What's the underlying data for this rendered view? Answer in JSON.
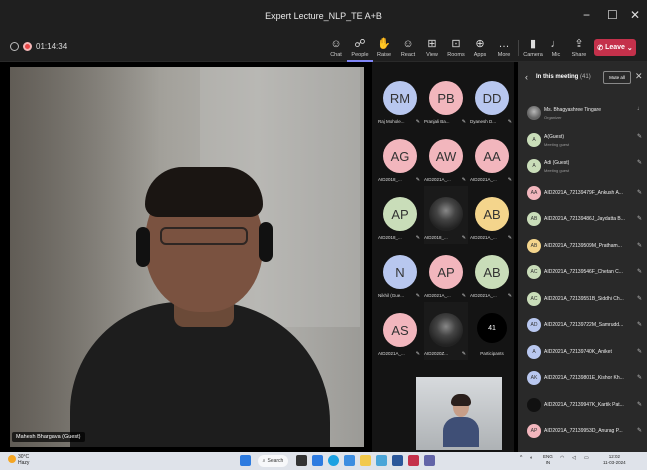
{
  "window": {
    "title": "Expert Lecture_NLP_TE A+B",
    "controls": [
      "−",
      "☐",
      "✕"
    ]
  },
  "toolbar": {
    "timer": "01:14:34",
    "buttons": [
      {
        "label": "Chat",
        "icon": "chat-icon",
        "glyph": "☺"
      },
      {
        "label": "People",
        "icon": "people-icon",
        "glyph": "☍"
      },
      {
        "label": "Raise",
        "icon": "raise-hand-icon",
        "glyph": "✋"
      },
      {
        "label": "React",
        "icon": "react-icon",
        "glyph": "☺"
      },
      {
        "label": "View",
        "icon": "view-icon",
        "glyph": "⊞"
      },
      {
        "label": "Rooms",
        "icon": "rooms-icon",
        "glyph": "⊡"
      },
      {
        "label": "Apps",
        "icon": "apps-icon",
        "glyph": "⊕"
      },
      {
        "label": "More",
        "icon": "more-icon",
        "glyph": "…"
      },
      {
        "label": "Camera",
        "icon": "camera-icon",
        "glyph": "▮"
      },
      {
        "label": "Mic",
        "icon": "mic-icon",
        "glyph": "♩"
      },
      {
        "label": "Share",
        "icon": "share-icon",
        "glyph": "⇪"
      }
    ],
    "leave_label": "Leave"
  },
  "stage": {
    "speaker_name": "Mahesh Bhargava (Guest)"
  },
  "gallery": {
    "tiles": [
      {
        "initials": "RM",
        "name": "Raj Mohole...",
        "color": "#b8c7ef"
      },
      {
        "initials": "PB",
        "name": "Pranjali Ba...",
        "color": "#f2b6bd"
      },
      {
        "initials": "DD",
        "name": "Dyanesh D...",
        "color": "#b8c7ef"
      },
      {
        "initials": "AG",
        "name": "AID2018_...",
        "color": "#f2b6bd"
      },
      {
        "initials": "AW",
        "name": "AID2021A_...",
        "color": "#f2b6bd"
      },
      {
        "initials": "AA",
        "name": "AID2021A_...",
        "color": "#f2b6bd"
      },
      {
        "initials": "AP",
        "name": "AID2018_...",
        "color": "#c9ddb9"
      },
      {
        "initials": "",
        "name": "AID2018_...",
        "color": "#333333",
        "photo": true
      },
      {
        "initials": "AB",
        "name": "AID2021A_...",
        "color": "#f4d58c"
      },
      {
        "initials": "N",
        "name": "Nikhil (Gue...",
        "color": "#b8c7ef"
      },
      {
        "initials": "AP",
        "name": "AID2021A_...",
        "color": "#f2b6bd"
      },
      {
        "initials": "AB",
        "name": "AID2021A_...",
        "color": "#c9ddb9"
      },
      {
        "initials": "AS",
        "name": "AID2021A_...",
        "color": "#f2b6bd"
      },
      {
        "initials": "",
        "name": "AID2020Z...",
        "color": "#333333",
        "photo": true
      },
      {
        "initials": "41",
        "name": "Participants",
        "color": "#000000",
        "count": true
      }
    ]
  },
  "panel": {
    "title": "In this meeting",
    "count": "(41)",
    "mute_all_label": "Mute all",
    "participants": [
      {
        "initials": "",
        "name": "Ms. Bhagyashree Tingare",
        "role": "Organizer",
        "photo": true,
        "color": "#999999"
      },
      {
        "initials": "A",
        "name": "A(Guest)",
        "role": "Meeting guest",
        "color": "#c9ddb9"
      },
      {
        "initials": "A",
        "name": "Adi (Guest)",
        "role": "Meeting guest",
        "color": "#c9ddb9"
      },
      {
        "initials": "AA",
        "name": "AID2021A_72139479F_Ankush A...",
        "role": "",
        "color": "#f2b6bd"
      },
      {
        "initials": "AB",
        "name": "AID2021A_72139486J_Jaydatta B...",
        "role": "",
        "color": "#c9ddb9"
      },
      {
        "initials": "AB",
        "name": "AID2021A_72139509M_Pratham...",
        "role": "",
        "color": "#f4d58c"
      },
      {
        "initials": "AC",
        "name": "AID2021A_72139546F_Chetan C...",
        "role": "",
        "color": "#c9ddb9"
      },
      {
        "initials": "AC",
        "name": "AID2021A_72139551B_Siddhi Ch...",
        "role": "",
        "color": "#c9ddb9"
      },
      {
        "initials": "AD",
        "name": "AID2021A_72139722M_Samrudd...",
        "role": "",
        "color": "#b8c7ef"
      },
      {
        "initials": "A",
        "name": "AID2021A_72139740K_Aniket",
        "role": "",
        "color": "#b8c7ef"
      },
      {
        "initials": "AK",
        "name": "AID2021A_72139801E_Kishor Kh...",
        "role": "",
        "color": "#b8c7ef"
      },
      {
        "initials": "",
        "name": "AID2021A_72139947K_Kartik Pat...",
        "role": "",
        "color": "#111111"
      },
      {
        "initials": "AP",
        "name": "AID2021A_72139953D_Anurag P...",
        "role": "",
        "color": "#f2b6bd"
      }
    ]
  },
  "taskbar": {
    "temperature": "30°C",
    "weather": "Hazy",
    "search_label": "Search",
    "lang_top": "ENG",
    "lang_bottom": "IN",
    "time": "12:02",
    "date": "11-03-2024"
  }
}
